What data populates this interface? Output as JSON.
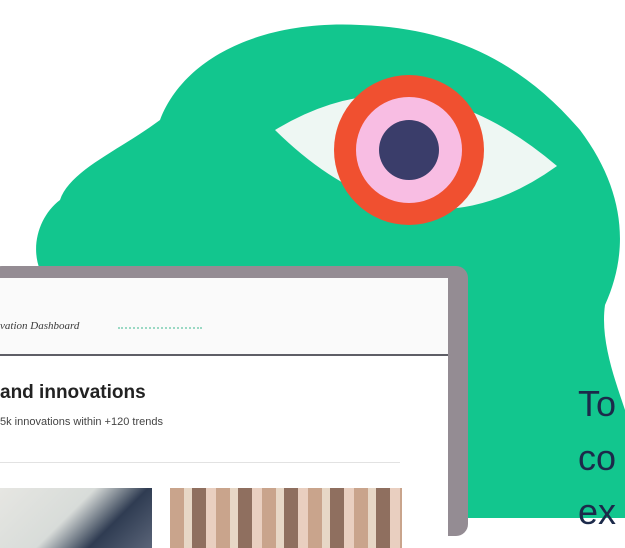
{
  "colors": {
    "blob": "#12c68e",
    "eye_white": "#eef7f3",
    "iris_outer": "#f05030",
    "iris_inner": "#f8bde3",
    "pupil": "#3a3d6a",
    "laptop_frame": "#948c93"
  },
  "dashboard": {
    "title": "vation Dashboard",
    "heading": "and innovations",
    "subtext": "5k innovations within +120 trends"
  },
  "side_text": {
    "line1": "To",
    "line2": "co",
    "line3": "ex"
  }
}
